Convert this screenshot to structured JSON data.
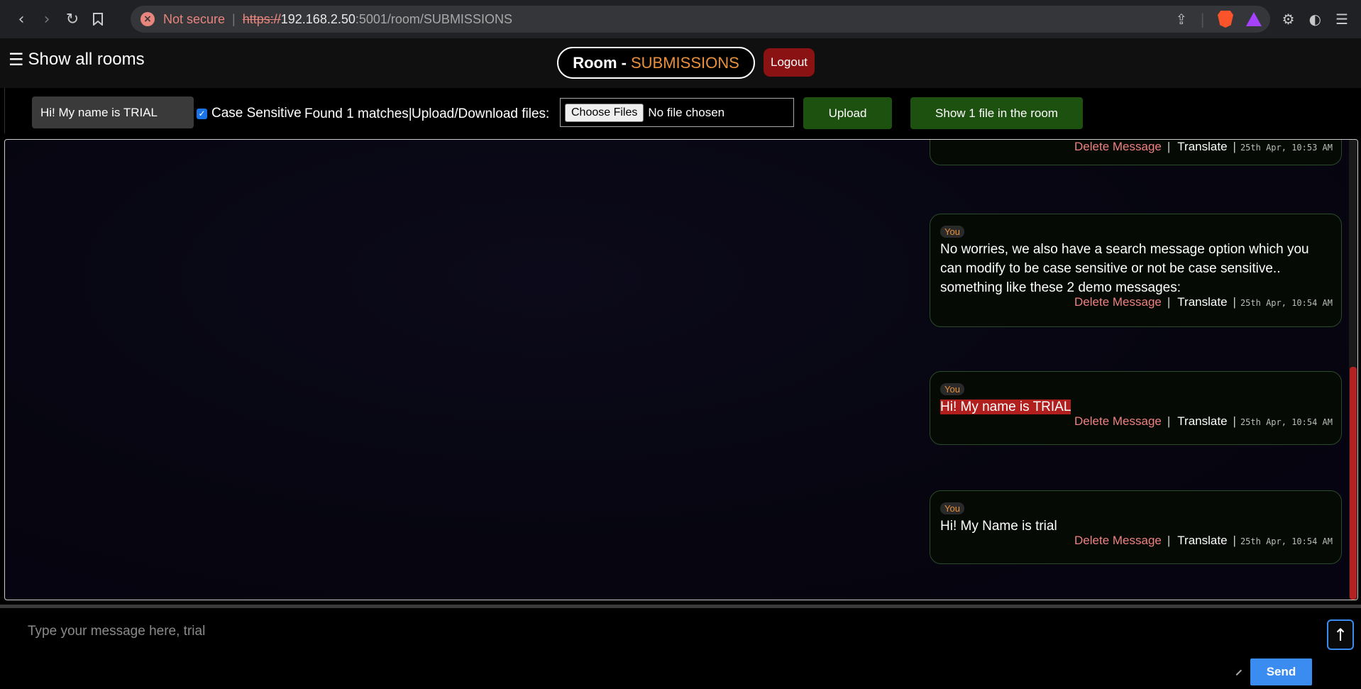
{
  "browser": {
    "security_label": "Not secure",
    "url_scheme": "https://",
    "url_host": "192.168.2.50",
    "url_path": ":5001/room/SUBMISSIONS"
  },
  "header": {
    "menu_label": "Show all rooms",
    "room_prefix": "Room -",
    "room_name": "SUBMISSIONS",
    "logout_label": "Logout"
  },
  "toolbar": {
    "search_value": "Hi! My name is TRIAL",
    "case_sensitive_label": "Case Sensitive",
    "case_sensitive_checked": true,
    "found_text": "Found 1 matches|",
    "upload_label": "Upload/Download files:",
    "choose_files_label": "Choose Files",
    "no_file_label": "No file chosen",
    "upload_button": "Upload",
    "show_files_button": "Show 1 file in the room"
  },
  "messages": [
    {
      "sender": "",
      "text": "",
      "delete_label": "Delete Message",
      "translate_label": "Translate",
      "timestamp": "25th Apr, 10:53 AM"
    },
    {
      "sender": "You",
      "text": "No worries, we also have a search message option which you can modify to be case sensitive or not be case sensitive.. something like these 2 demo messages:",
      "delete_label": "Delete Message",
      "translate_label": "Translate",
      "timestamp": "25th Apr, 10:54 AM"
    },
    {
      "sender": "You",
      "text": "Hi! My name is TRIAL",
      "highlighted": true,
      "delete_label": "Delete Message",
      "translate_label": "Translate",
      "timestamp": "25th Apr, 10:54 AM"
    },
    {
      "sender": "You",
      "text": "Hi! My Name is trial",
      "delete_label": "Delete Message",
      "translate_label": "Translate",
      "timestamp": "25th Apr, 10:54 AM"
    }
  ],
  "compose": {
    "placeholder": "Type your message here, trial",
    "send_label": "Send"
  },
  "colors": {
    "accent_orange": "#e8903a",
    "logout_red": "#8b1212",
    "action_green": "#1d5110",
    "highlight_red": "#b01e1e",
    "send_blue": "#3b8cf0"
  },
  "icons": [
    "back-icon",
    "forward-icon",
    "reload-icon",
    "bookmark-icon",
    "not-secure-icon",
    "share-icon",
    "brave-shields-icon",
    "brave-rewards-icon",
    "extensions-icon",
    "profile-icon",
    "menu-icon",
    "hamburger-icon",
    "arrow-up-icon"
  ]
}
